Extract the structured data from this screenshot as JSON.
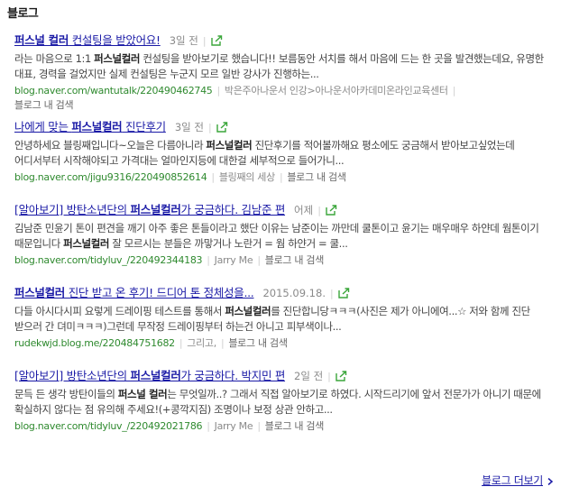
{
  "section": {
    "title": "블로그"
  },
  "results": [
    {
      "title_bold": "퍼스널 컬러",
      "title_rest": " 컨설팅을 받았어요!",
      "date": "3일 전",
      "snippet_a": "라는 마음으로 1:1 ",
      "snippet_bold": "퍼스널컬러",
      "snippet_b": " 컨설팅을 받아보기로 했습니다!! 보름동안 서치를 해서 마음에 드는 한 곳을 발견했는데요, 유명한 대표, 경력을 걸었지만 실제 컨설팅은 누군지 모르 일반 강사가 진행하는...",
      "url": "blog.naver.com/wantutalk/220490462745",
      "blog_name": "박은주아나운서 인강>아나운서아카데미온라인교육센터",
      "in_blog": "블로그 내 검색"
    },
    {
      "title_pre": "나에게 맞는 ",
      "title_bold": "퍼스널컬러",
      "title_rest": " 진단후기",
      "date": "3일 전",
      "snippet_a": "안녕하세요 블링째입니다~오늘은 다름아니라 ",
      "snippet_bold": "퍼스널컬러",
      "snippet_b": " 진단후기를 적어볼까해요 평소에도 궁금해서 받아보고싶었는데 어디서부터 시작해야되고 가격대는 얼마인지등에 대한걸 세부적으로 들어가니...",
      "url": "blog.naver.com/jigu9316/220490852614",
      "blog_name": "블링째의 세상",
      "in_blog": "블로그 내 검색"
    },
    {
      "title_pre": "[알아보기] 방탄소년단의 ",
      "title_bold": "퍼스널컬러",
      "title_rest": "가 궁금하다. 김남준 편",
      "date": "어제",
      "snippet_a": "김남준 민윤기 톤이 편견을 깨기 아주 좋은 톤들이라고 했단 이유는 남준이는 까만데 쿨톤이고 윤기는 매우매우 하얀데 웜톤이기 때문입니다 ",
      "snippet_bold": "퍼스널컬러",
      "snippet_b": " 잘 모르시는 분들은 까맣거나 노란거 = 웜 하얀거 = 쿨...",
      "url": "blog.naver.com/tidyluv_/220492344183",
      "blog_name": "Jarry Me",
      "in_blog": "블로그 내 검색"
    },
    {
      "title_bold": "퍼스널컬러",
      "title_rest": " 진단 받고 온 후기! 드디어 톤 정체성을...",
      "date": "2015.09.18.",
      "snippet_a": "다들 아시다시피 요렇게 드레이핑 테스트를 통해서 ",
      "snippet_bold": "퍼스널컬러",
      "snippet_b": "를 진단합니당ㅋㅋㅋ(사진은 제가 아니에여...☆ 저와 함께 진단 받으러 간 뎌미ㅋㅋㅋ)그런데 무작정 드레이핑부터 하는건 아니고 피부색이나...",
      "url": "rudekwjd.blog.me/220484751682",
      "blog_name": "그리고,",
      "in_blog": "블로그 내 검색"
    },
    {
      "title_pre": "[알아보기] 방탄소년단의 ",
      "title_bold": "퍼스널컬러",
      "title_rest": "가 궁금하다. 박지민 편",
      "date": "2일 전",
      "snippet_a": "문득 든 생각 방탄이들의 ",
      "snippet_bold": "퍼스널 컬러",
      "snippet_b": "는 무엇일까..? 그래서 직접 알아보기로 하였다. 시작드리기에 앞서 전문가가 아니기 때문에 확실하지 않다는 점 유의해 주세요!(+콩깍지짐) 조명이나 보정 상관 안하고...",
      "url": "blog.naver.com/tidyluv_/220492021786",
      "blog_name": "Jarry Me",
      "in_blog": "블로그 내 검색"
    }
  ],
  "more": {
    "label": "블로그 더보기"
  },
  "colors": {
    "link": "#1a1aa6",
    "url": "#2f8a2f",
    "meta": "#8a8a8a",
    "share": "#3aa63a"
  }
}
